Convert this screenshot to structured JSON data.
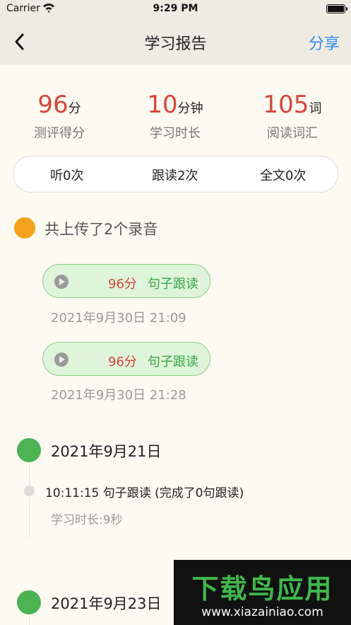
{
  "status_bar": {
    "carrier": "Carrier",
    "time": "9:29 PM"
  },
  "nav": {
    "title": "学习报告",
    "share_label": "分享"
  },
  "stats": [
    {
      "value": "96",
      "unit": "分",
      "label": "测评得分"
    },
    {
      "value": "10",
      "unit": "分钟",
      "label": "学习时长"
    },
    {
      "value": "105",
      "unit": "词",
      "label": "阅读词汇"
    }
  ],
  "counts": {
    "listen": "听0次",
    "follow": "跟读2次",
    "full": "全文0次"
  },
  "uploads": {
    "title": "共上传了2个录音",
    "items": [
      {
        "score": "96分",
        "type": "句子跟读",
        "time": "2021年9月30日 21:09"
      },
      {
        "score": "96分",
        "type": "句子跟读",
        "time": "2021年9月30日 21:28"
      }
    ]
  },
  "timeline": [
    {
      "date": "2021年9月21日",
      "entry": "10:11:15 句子跟读 (完成了0句跟读)",
      "duration": "学习时长:9秒"
    },
    {
      "date": "2021年9月23日"
    }
  ],
  "watermark": {
    "title": "下载鸟应用",
    "url": "www.xiazainiao.com"
  },
  "colors": {
    "accent_red": "#d9443a",
    "accent_green": "#4bb352",
    "accent_orange": "#f5a31a",
    "link_blue": "#2f8ee8"
  }
}
